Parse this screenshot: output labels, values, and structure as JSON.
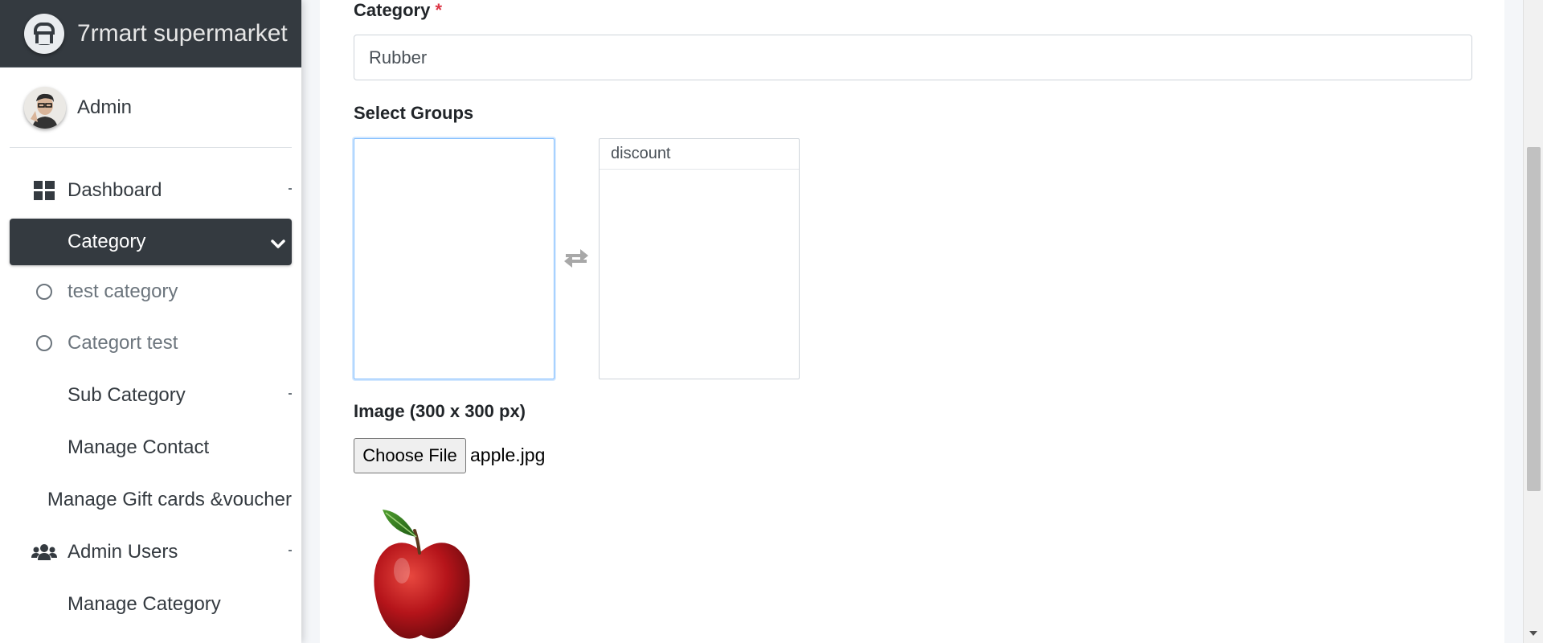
{
  "brand": {
    "name": "7rmart supermarket"
  },
  "user": {
    "name": "Admin"
  },
  "sidebar": {
    "items": [
      {
        "label": "Dashboard",
        "icon": "dashboard-icon"
      },
      {
        "label": "Category",
        "icon": "none",
        "expanded": true
      },
      {
        "label": "test category",
        "icon": "circle-icon"
      },
      {
        "label": "Categort test",
        "icon": "circle-icon"
      },
      {
        "label": "Sub Category",
        "icon": "none"
      },
      {
        "label": "Manage Contact",
        "icon": "none"
      },
      {
        "label": "Manage Gift cards &voucher",
        "icon": "none"
      },
      {
        "label": "Admin Users",
        "icon": "users-icon"
      },
      {
        "label": "Manage Category",
        "icon": "none"
      }
    ]
  },
  "form": {
    "category_label": "Category",
    "required_marker": "*",
    "category_value": "Rubber",
    "groups_label": "Select Groups",
    "available_groups": [],
    "selected_groups": [
      "discount"
    ],
    "image_label": "Image (300 x 300 px)",
    "choose_file_label": "Choose File",
    "file_name": "apple.jpg"
  },
  "colors": {
    "sidebar_active_bg": "#343a40",
    "brand_bg": "#343a40",
    "required": "#dc3545",
    "focus_border": "#80bdff"
  }
}
